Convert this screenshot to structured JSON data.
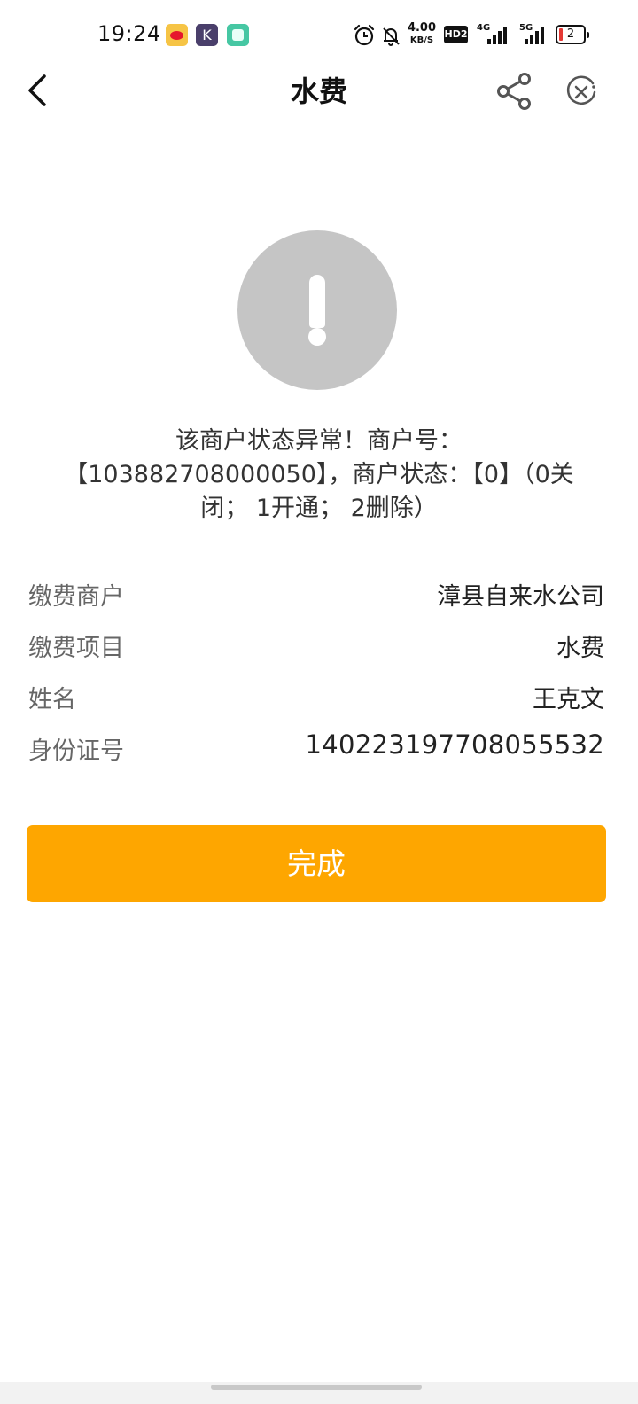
{
  "status_bar": {
    "time": "19:24",
    "apps": [
      "weibo-icon",
      "k-app-icon",
      "green-app-icon"
    ],
    "k_app_letter": "K",
    "net_speed_value": "4.00",
    "net_speed_unit": "KB/S",
    "hd_badge": "HD2",
    "signal_1_label": "4G",
    "signal_2_label": "5G",
    "battery_level": "2",
    "battery_color": "#e53935"
  },
  "nav": {
    "title": "水费",
    "back_icon": "chevron-left-icon",
    "share_icon": "share-icon",
    "close_icon": "close-circle-icon"
  },
  "warning": {
    "icon": "exclamation-icon",
    "circle_color": "#c5c5c5",
    "line1": "该商户状态异常！商户号：",
    "line2": "【103882708000050】，商户状态：【0】（0关",
    "line3": "闭； 1开通； 2删除）"
  },
  "info": [
    {
      "label": "缴费商户",
      "value": "漳县自来水公司"
    },
    {
      "label": "缴费项目",
      "value": "水费"
    },
    {
      "label": "姓名",
      "value": "王克文"
    },
    {
      "label": "身份证号",
      "value": "140223197708055532"
    }
  ],
  "done_button": {
    "label": "完成",
    "color": "#fea600"
  }
}
